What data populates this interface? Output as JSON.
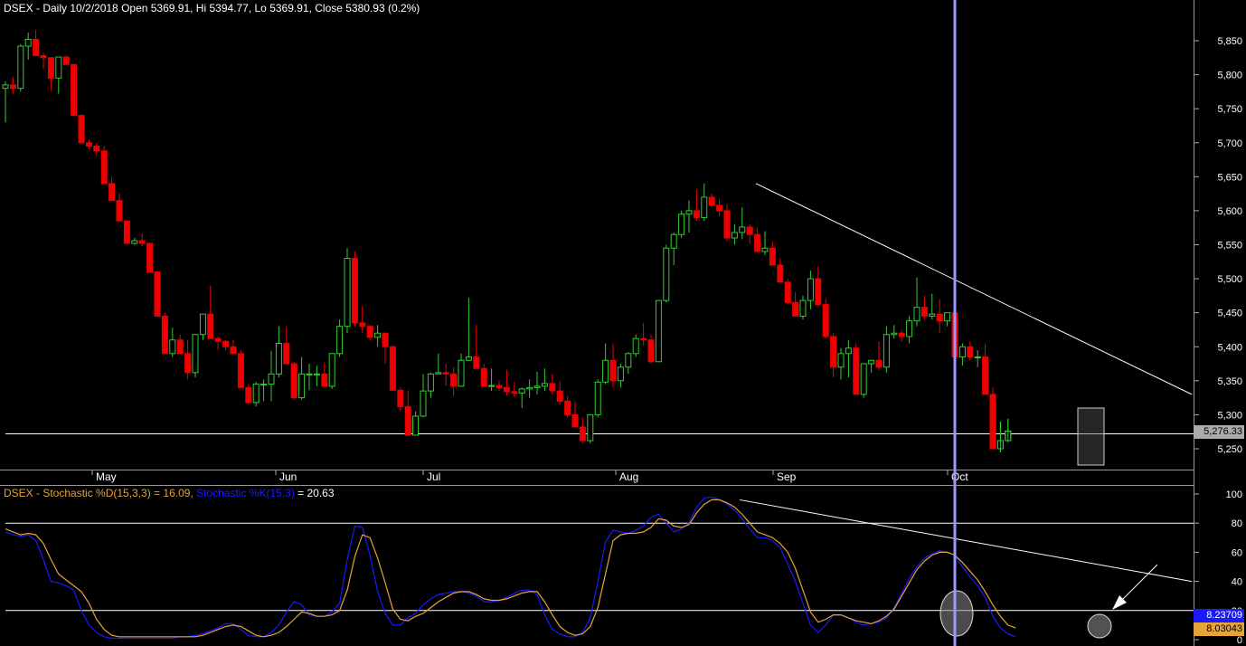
{
  "price_header": "DSEX - Daily 10/2/2018 Open 5369.91, Hi 5394.77, Lo 5369.91, Close 5380.93 (0.2%)",
  "stoch_header": {
    "part1": "DSEX - Stochastic %D(15,3,3) = 16.09, ",
    "part2": "Stochastic %K(15,3)",
    "part3": " = 20.63"
  },
  "colors": {
    "background": "#000000",
    "bull_outline": "#33cc33",
    "bear_fill": "#ee0000",
    "cursor_line": "#9999ff",
    "stoch_d": "#e6a33a",
    "stoch_k": "#1a1aff",
    "grid_line": "#ffffff"
  },
  "price_axis": {
    "ticks": [
      "5,850",
      "5,800",
      "5,750",
      "5,700",
      "5,650",
      "5,600",
      "5,550",
      "5,500",
      "5,450",
      "5,400",
      "5,350",
      "5,300",
      "5,250"
    ],
    "range": [
      5215,
      5880
    ],
    "last_price_label": "5,276.33",
    "reference_level": 5272
  },
  "month_labels": [
    "May",
    "Jun",
    "Jul",
    "Aug",
    "Sep",
    "Oct"
  ],
  "stoch_axis": {
    "ticks": [
      "100",
      "80",
      "60",
      "40",
      "20",
      "0"
    ],
    "range": [
      0,
      100
    ],
    "k_label": "8.23709",
    "d_label": "8.03043",
    "levels": [
      80,
      20
    ]
  },
  "chart_data": {
    "type": "candlestick",
    "title": "DSEX - Daily 10/2/2018 Open 5369.91, Hi 5394.77, Lo 5369.91, Close 5380.93 (0.2%)",
    "x": "trading days (late Apr 2018 – Oct 2018)",
    "candles": [
      [
        5780,
        5790,
        5730,
        5785
      ],
      [
        5785,
        5797,
        5772,
        5780
      ],
      [
        5780,
        5845,
        5775,
        5842
      ],
      [
        5842,
        5862,
        5822,
        5852
      ],
      [
        5852,
        5866,
        5828,
        5828
      ],
      [
        5828,
        5832,
        5808,
        5825
      ],
      [
        5825,
        5826,
        5776,
        5795
      ],
      [
        5795,
        5815,
        5772,
        5826
      ],
      [
        5826,
        5828,
        5818,
        5815
      ],
      [
        5815,
        5815,
        5740,
        5740
      ],
      [
        5740,
        5742,
        5700,
        5700
      ],
      [
        5700,
        5705,
        5690,
        5695
      ],
      [
        5695,
        5700,
        5680,
        5688
      ],
      [
        5688,
        5695,
        5640,
        5640
      ],
      [
        5640,
        5650,
        5615,
        5615
      ],
      [
        5615,
        5625,
        5585,
        5585
      ],
      [
        5585,
        5585,
        5552,
        5552
      ],
      [
        5552,
        5560,
        5550,
        5556
      ],
      [
        5556,
        5566,
        5548,
        5552
      ],
      [
        5552,
        5553,
        5510,
        5510
      ],
      [
        5510,
        5512,
        5445,
        5445
      ],
      [
        5445,
        5450,
        5390,
        5390
      ],
      [
        5390,
        5428,
        5385,
        5410
      ],
      [
        5410,
        5418,
        5395,
        5390
      ],
      [
        5390,
        5410,
        5352,
        5362
      ],
      [
        5362,
        5418,
        5355,
        5418
      ],
      [
        5418,
        5448,
        5410,
        5448
      ],
      [
        5448,
        5490,
        5425,
        5412
      ],
      [
        5412,
        5415,
        5395,
        5408
      ],
      [
        5408,
        5410,
        5395,
        5400
      ],
      [
        5400,
        5410,
        5390,
        5390
      ],
      [
        5390,
        5395,
        5340,
        5340
      ],
      [
        5340,
        5345,
        5315,
        5318
      ],
      [
        5318,
        5348,
        5312,
        5345
      ],
      [
        5345,
        5352,
        5320,
        5345
      ],
      [
        5345,
        5394,
        5320,
        5360
      ],
      [
        5360,
        5430,
        5355,
        5405
      ],
      [
        5405,
        5430,
        5375,
        5375
      ],
      [
        5375,
        5378,
        5322,
        5325
      ],
      [
        5325,
        5385,
        5322,
        5360
      ],
      [
        5360,
        5375,
        5336,
        5360
      ],
      [
        5360,
        5372,
        5342,
        5360
      ],
      [
        5360,
        5377,
        5342,
        5342
      ],
      [
        5342,
        5390,
        5338,
        5390
      ],
      [
        5390,
        5440,
        5385,
        5430
      ],
      [
        5430,
        5545,
        5420,
        5530
      ],
      [
        5530,
        5540,
        5430,
        5435
      ],
      [
        5435,
        5460,
        5420,
        5430
      ],
      [
        5430,
        5432,
        5410,
        5414
      ],
      [
        5414,
        5432,
        5400,
        5420
      ],
      [
        5420,
        5420,
        5375,
        5400
      ],
      [
        5400,
        5402,
        5335,
        5336
      ],
      [
        5336,
        5340,
        5305,
        5312
      ],
      [
        5312,
        5336,
        5270,
        5270
      ],
      [
        5270,
        5305,
        5270,
        5298
      ],
      [
        5298,
        5360,
        5296,
        5335
      ],
      [
        5335,
        5362,
        5325,
        5360
      ],
      [
        5360,
        5390,
        5360,
        5362
      ],
      [
        5362,
        5375,
        5342,
        5360
      ],
      [
        5360,
        5370,
        5328,
        5342
      ],
      [
        5342,
        5390,
        5342,
        5380
      ],
      [
        5380,
        5472,
        5380,
        5385
      ],
      [
        5385,
        5432,
        5380,
        5368
      ],
      [
        5368,
        5375,
        5342,
        5342
      ],
      [
        5342,
        5368,
        5335,
        5343
      ],
      [
        5343,
        5350,
        5335,
        5340
      ],
      [
        5340,
        5366,
        5328,
        5334
      ],
      [
        5334,
        5348,
        5326,
        5332
      ],
      [
        5332,
        5340,
        5310,
        5338
      ],
      [
        5338,
        5352,
        5325,
        5340
      ],
      [
        5340,
        5363,
        5330,
        5342
      ],
      [
        5342,
        5368,
        5335,
        5346
      ],
      [
        5346,
        5360,
        5330,
        5335
      ],
      [
        5335,
        5350,
        5315,
        5320
      ],
      [
        5320,
        5328,
        5295,
        5300
      ],
      [
        5300,
        5320,
        5285,
        5282
      ],
      [
        5282,
        5296,
        5258,
        5262
      ],
      [
        5262,
        5290,
        5258,
        5300
      ],
      [
        5300,
        5352,
        5296,
        5348
      ],
      [
        5348,
        5405,
        5345,
        5380
      ],
      [
        5380,
        5405,
        5340,
        5350
      ],
      [
        5350,
        5375,
        5340,
        5370
      ],
      [
        5370,
        5392,
        5360,
        5390
      ],
      [
        5390,
        5418,
        5385,
        5412
      ],
      [
        5412,
        5435,
        5402,
        5410
      ],
      [
        5410,
        5418,
        5375,
        5378
      ],
      [
        5378,
        5455,
        5378,
        5468
      ],
      [
        5468,
        5550,
        5465,
        5545
      ],
      [
        5545,
        5568,
        5520,
        5565
      ],
      [
        5565,
        5600,
        5560,
        5595
      ],
      [
        5595,
        5615,
        5568,
        5600
      ],
      [
        5600,
        5632,
        5585,
        5590
      ],
      [
        5590,
        5640,
        5585,
        5620
      ],
      [
        5620,
        5625,
        5605,
        5608
      ],
      [
        5608,
        5618,
        5592,
        5600
      ],
      [
        5600,
        5610,
        5555,
        5560
      ],
      [
        5560,
        5580,
        5550,
        5568
      ],
      [
        5568,
        5605,
        5558,
        5576
      ],
      [
        5576,
        5580,
        5552,
        5565
      ],
      [
        5565,
        5575,
        5540,
        5540
      ],
      [
        5540,
        5570,
        5535,
        5545
      ],
      [
        5545,
        5555,
        5520,
        5520
      ],
      [
        5520,
        5530,
        5495,
        5495
      ],
      [
        5495,
        5500,
        5463,
        5465
      ],
      [
        5465,
        5480,
        5445,
        5445
      ],
      [
        5445,
        5475,
        5440,
        5468
      ],
      [
        5468,
        5512,
        5455,
        5500
      ],
      [
        5500,
        5518,
        5460,
        5462
      ],
      [
        5462,
        5470,
        5412,
        5415
      ],
      [
        5415,
        5420,
        5355,
        5370
      ],
      [
        5370,
        5398,
        5352,
        5390
      ],
      [
        5390,
        5410,
        5355,
        5398
      ],
      [
        5398,
        5405,
        5330,
        5330
      ],
      [
        5330,
        5350,
        5325,
        5375
      ],
      [
        5375,
        5380,
        5362,
        5380
      ],
      [
        5380,
        5408,
        5365,
        5370
      ],
      [
        5370,
        5430,
        5362,
        5418
      ],
      [
        5418,
        5432,
        5412,
        5420
      ],
      [
        5420,
        5425,
        5408,
        5415
      ],
      [
        5415,
        5445,
        5405,
        5438
      ],
      [
        5438,
        5502,
        5430,
        5458
      ],
      [
        5458,
        5475,
        5440,
        5445
      ],
      [
        5445,
        5478,
        5440,
        5448
      ],
      [
        5448,
        5470,
        5420,
        5438
      ],
      [
        5438,
        5450,
        5430,
        5450
      ],
      [
        5450,
        5455,
        5380,
        5385
      ],
      [
        5385,
        5405,
        5372,
        5400
      ],
      [
        5400,
        5408,
        5380,
        5385
      ],
      [
        5385,
        5395,
        5370,
        5385
      ],
      [
        5385,
        5405,
        5330,
        5330
      ],
      [
        5330,
        5340,
        5250,
        5250
      ],
      [
        5250,
        5290,
        5245,
        5262
      ],
      [
        5262,
        5294,
        5260,
        5276
      ]
    ],
    "trendline_price": [
      [
        5640,
        5640
      ],
      [
        5330,
        5330
      ]
    ],
    "stochastic": {
      "d_name": "Stochastic %D(15,3,3)",
      "k_name": "Stochastic %K(15,3)",
      "d_value": 16.09,
      "k_value": 20.63,
      "d": [
        76,
        74,
        72,
        73,
        72,
        66,
        55,
        45,
        41,
        37,
        33,
        25,
        14,
        7,
        3,
        2,
        2,
        2,
        2,
        2,
        2,
        2,
        2,
        2,
        2,
        2,
        3,
        5,
        7,
        9,
        10,
        9,
        6,
        3,
        2,
        3,
        5,
        9,
        14,
        19,
        18,
        16,
        16,
        17,
        20,
        34,
        57,
        72,
        70,
        56,
        39,
        21,
        14,
        13,
        16,
        18,
        22,
        26,
        29,
        32,
        33,
        33,
        31,
        28,
        27,
        27,
        28,
        30,
        32,
        33,
        33,
        26,
        17,
        9,
        5,
        3,
        4,
        9,
        22,
        45,
        68,
        72,
        73,
        73,
        74,
        77,
        83,
        82,
        78,
        77,
        79,
        87,
        93,
        96,
        96,
        94,
        91,
        86,
        80,
        74,
        72,
        70,
        66,
        60,
        49,
        34,
        19,
        12,
        14,
        17,
        17,
        15,
        13,
        12,
        11,
        13,
        16,
        21,
        30,
        39,
        48,
        54,
        58,
        60,
        60,
        58,
        53,
        47,
        41,
        33,
        24,
        16,
        10,
        8
      ],
      "k": [
        74,
        72,
        71,
        72,
        68,
        55,
        40,
        39,
        37,
        34,
        20,
        10,
        5,
        2,
        1,
        1,
        1,
        1,
        1,
        1,
        1,
        1,
        1,
        2,
        2,
        3,
        4,
        6,
        8,
        11,
        11,
        7,
        3,
        2,
        2,
        5,
        10,
        19,
        26,
        24,
        17,
        16,
        16,
        19,
        25,
        55,
        78,
        77,
        58,
        33,
        18,
        10,
        10,
        15,
        18,
        24,
        28,
        31,
        32,
        33,
        33,
        32,
        30,
        26,
        26,
        27,
        29,
        32,
        34,
        34,
        31,
        17,
        7,
        4,
        2,
        2,
        5,
        15,
        40,
        67,
        75,
        74,
        73,
        75,
        78,
        84,
        86,
        80,
        74,
        76,
        80,
        91,
        97,
        98,
        96,
        93,
        89,
        83,
        76,
        70,
        70,
        68,
        63,
        52,
        40,
        25,
        10,
        5,
        10,
        17,
        17,
        15,
        12,
        10,
        11,
        12,
        15,
        22,
        32,
        42,
        50,
        56,
        59,
        61,
        60,
        58,
        50,
        43,
        37,
        29,
        16,
        8,
        4,
        2
      ]
    },
    "trendline_stoch": [
      [
        96,
        96
      ],
      [
        40,
        40
      ]
    ],
    "levels": [
      80,
      20
    ]
  }
}
